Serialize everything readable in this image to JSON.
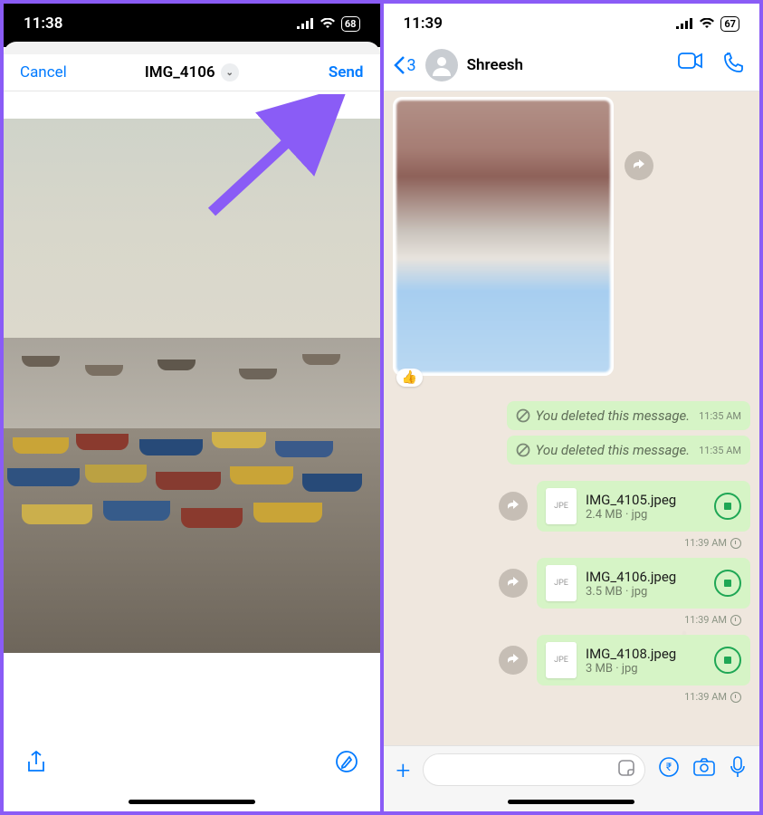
{
  "left": {
    "status": {
      "time": "11:38",
      "battery": "68"
    },
    "header": {
      "cancel": "Cancel",
      "title": "IMG_4106",
      "send": "Send"
    },
    "toolbar": {
      "share_icon": "share-icon",
      "markup_icon": "markup-icon"
    }
  },
  "right": {
    "status": {
      "time": "11:39",
      "battery": "67"
    },
    "header": {
      "back_count": "3",
      "contact_name": "Shreesh"
    },
    "deleted": {
      "text": "You deleted this message.",
      "items": [
        {
          "time": "11:35 AM"
        },
        {
          "time": "11:35 AM"
        }
      ]
    },
    "files": [
      {
        "name": "IMG_4105.jpeg",
        "size": "2.4 MB",
        "ext": "jpg",
        "time": "11:39 AM",
        "icon_label": "JPE"
      },
      {
        "name": "IMG_4106.jpeg",
        "size": "3.5 MB",
        "ext": "jpg",
        "time": "11:39 AM",
        "icon_label": "JPE"
      },
      {
        "name": "IMG_4108.jpeg",
        "size": "3 MB",
        "ext": "jpg",
        "time": "11:39 AM",
        "icon_label": "JPE"
      }
    ],
    "reaction_emoji": "👍"
  }
}
